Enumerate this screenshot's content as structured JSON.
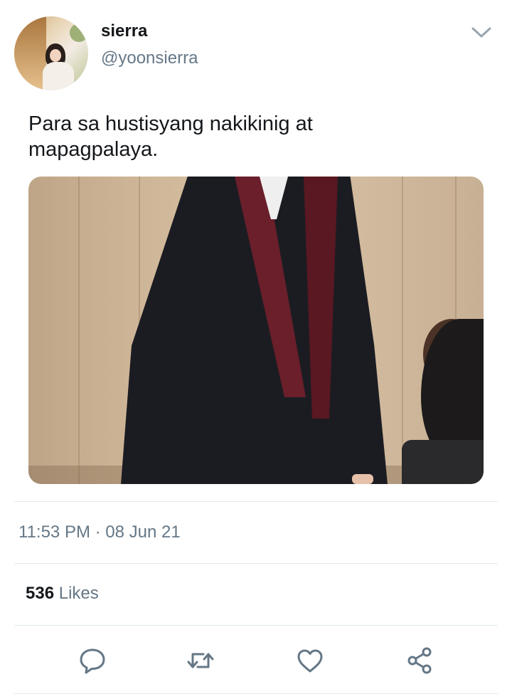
{
  "tweet": {
    "display_name": "sierra",
    "handle": "@yoonsierra",
    "text_lines": [
      "Para sa hustisyang nakikinig at",
      "mapagpalaya."
    ],
    "timestamp": "11:53 PM · 08 Jun 21",
    "likes_count": "536",
    "likes_label": "Likes"
  },
  "icons": {
    "menu": "chevron-down-icon",
    "reply": "reply-icon",
    "retweet": "retweet-icon",
    "like": "heart-icon",
    "share": "share-icon"
  },
  "colors": {
    "primary_text": "#14171a",
    "secondary_text": "#657786",
    "divider": "#e1e8ed",
    "icon": "#657786"
  }
}
